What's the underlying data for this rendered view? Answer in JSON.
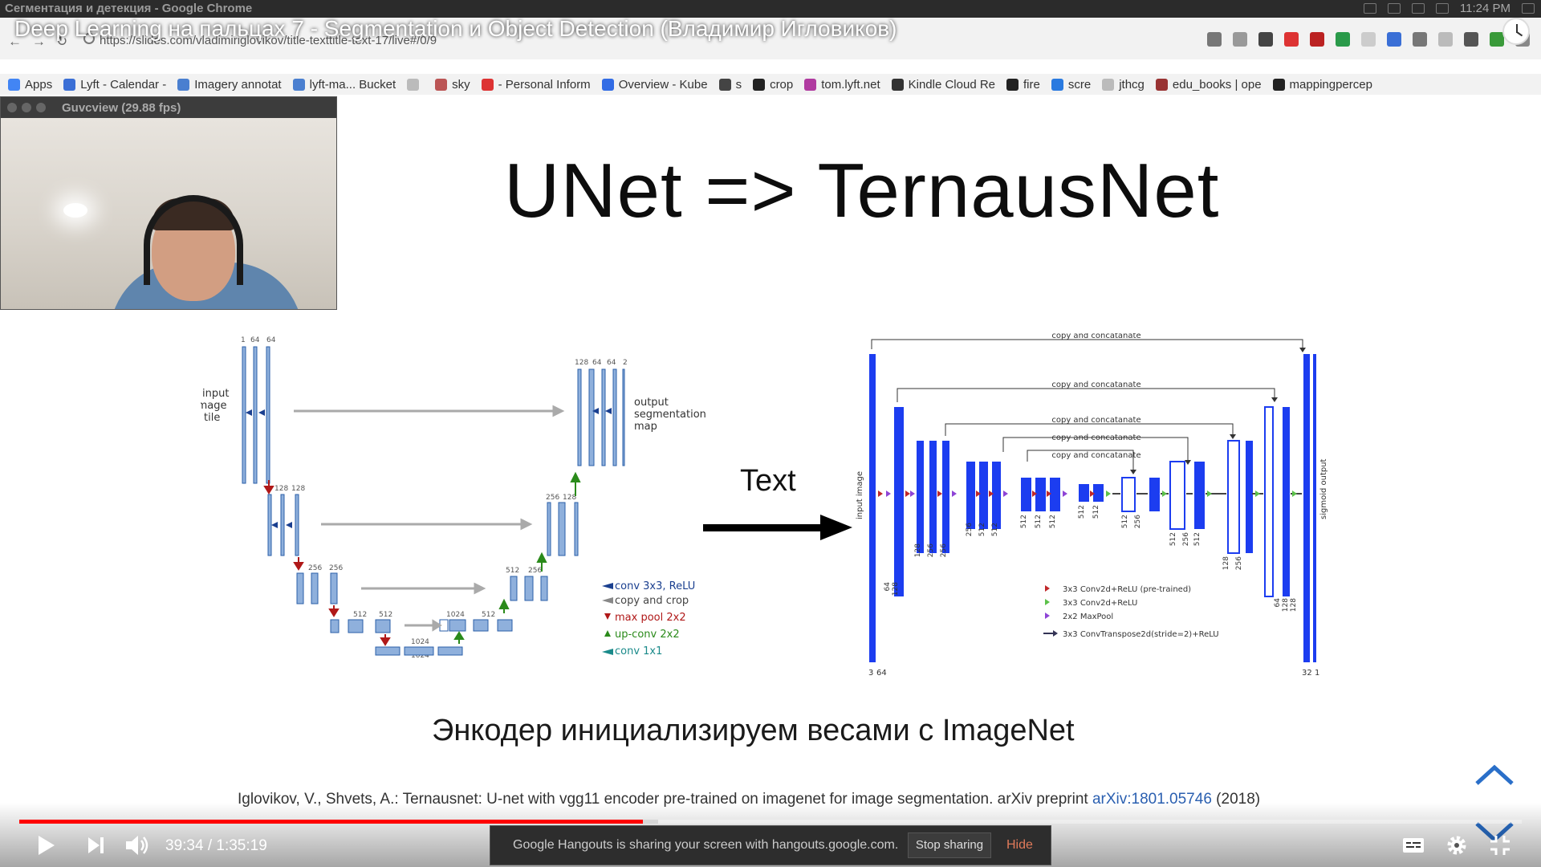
{
  "os": {
    "window_title": "Сегментация и детекция - Google Chrome",
    "clock": "11:24 PM"
  },
  "video": {
    "title": "Deep Learning на пальцах 7 - Segmentation и Object Detection (Владимир Игловиков)",
    "current_time": "39:34",
    "separator": " / ",
    "duration": "1:35:19",
    "progress_fraction": 0.415,
    "buffer_fraction": 0.425
  },
  "browser": {
    "url": "https://slides.com/vladimiriglovikov/title-texttitle-text-17/live#/0/9",
    "bookmarks": [
      {
        "label": "Apps",
        "color": "#4285f4"
      },
      {
        "label": "Lyft - Calendar -",
        "color": "#3b6fd6"
      },
      {
        "label": "Imagery annotat",
        "color": "#4a7fd0"
      },
      {
        "label": "lyft-ma... Bucket",
        "color": "#4a7fd0"
      },
      {
        "label": "",
        "color": "#bbbbbb"
      },
      {
        "label": "sky",
        "color": "#b55"
      },
      {
        "label": "- Personal Inform",
        "color": "#d33"
      },
      {
        "label": "Overview - Kube",
        "color": "#326ce5"
      },
      {
        "label": "s",
        "color": "#444"
      },
      {
        "label": "crop",
        "color": "#222"
      },
      {
        "label": "tom.lyft.net",
        "color": "#b03aa0"
      },
      {
        "label": "Kindle Cloud Re",
        "color": "#333"
      },
      {
        "label": "fire",
        "color": "#222"
      },
      {
        "label": "scre",
        "color": "#2a7ae0"
      },
      {
        "label": "jthcg",
        "color": "#bbbbbb"
      },
      {
        "label": "edu_books | ope",
        "color": "#933"
      },
      {
        "label": "mappingpercep",
        "color": "#222"
      }
    ]
  },
  "webcam": {
    "title": "Guvcview  (29.88 fps)"
  },
  "slide": {
    "title": "UNet => TernausNet",
    "arrow_label": "Text",
    "subtitle": "Энкодер инициализируем весами с ImageNet",
    "citation_text": "Iglovikov, V., Shvets, A.: Ternausnet: U-net with vgg11 encoder pre-trained on imagenet for image segmentation. arXiv preprint ",
    "citation_link": "arXiv:1801.05746",
    "citation_year": " (2018)"
  },
  "unet": {
    "input_label": [
      "input",
      "image",
      "tile"
    ],
    "output_label": [
      "output",
      "segmentation",
      "map"
    ],
    "top_channels_left": [
      "1",
      "64",
      "64"
    ],
    "top_channels_right": [
      "128",
      "64",
      "64",
      "2"
    ],
    "level2_channels": [
      "128",
      "128"
    ],
    "level3_channels": [
      "256",
      "256"
    ],
    "level4_channels": [
      "512",
      "512"
    ],
    "bottom_channels": [
      "1024",
      "1024"
    ],
    "up3_channels": [
      "512",
      "256"
    ],
    "up2_channels": [
      "256",
      "128"
    ],
    "up4_channels": [
      "1024",
      "512"
    ],
    "legend": [
      {
        "label": "conv 3x3, ReLU",
        "color": "#1a3f8f"
      },
      {
        "label": "copy and crop",
        "color": "#888888"
      },
      {
        "label": "max pool 2x2",
        "color": "#b01818"
      },
      {
        "label": "up-conv 2x2",
        "color": "#2a8a1a"
      },
      {
        "label": "conv 1x1",
        "color": "#1a8a8a"
      }
    ]
  },
  "ternaus": {
    "copy_label": "copy and concatanate",
    "input_label": "input image",
    "output_label": "sigmoid output",
    "bottom_left": [
      "3",
      "64"
    ],
    "bottom_right": [
      "32",
      "1"
    ],
    "channel_labels": [
      "64",
      "128",
      "128",
      "256",
      "256",
      "256",
      "512",
      "512",
      "512",
      "512",
      "512",
      "512",
      "512",
      "512",
      "256",
      "512",
      "256",
      "512",
      "128",
      "256",
      "64",
      "128",
      "128"
    ],
    "legend": [
      {
        "label": "3x3 Conv2d+ReLU (pre-trained)",
        "color": "#c0282a"
      },
      {
        "label": "3x3 Conv2d+ReLU",
        "color": "#5cc14a"
      },
      {
        "label": "2x2 MaxPool",
        "color": "#8e44d6"
      },
      {
        "label": "3x3 ConvTranspose2d(stride=2)+ReLU",
        "color": "#333355"
      }
    ]
  },
  "hangouts": {
    "message": "Google Hangouts is sharing your screen with hangouts.google.com.",
    "stop_label": "Stop sharing",
    "hide_label": "Hide"
  },
  "icons": {
    "play": "play-icon",
    "next": "next-icon",
    "volume": "volume-icon",
    "subtitles": "subtitles-icon",
    "settings": "gear-icon",
    "fullscreen": "exit-fullscreen-icon"
  }
}
